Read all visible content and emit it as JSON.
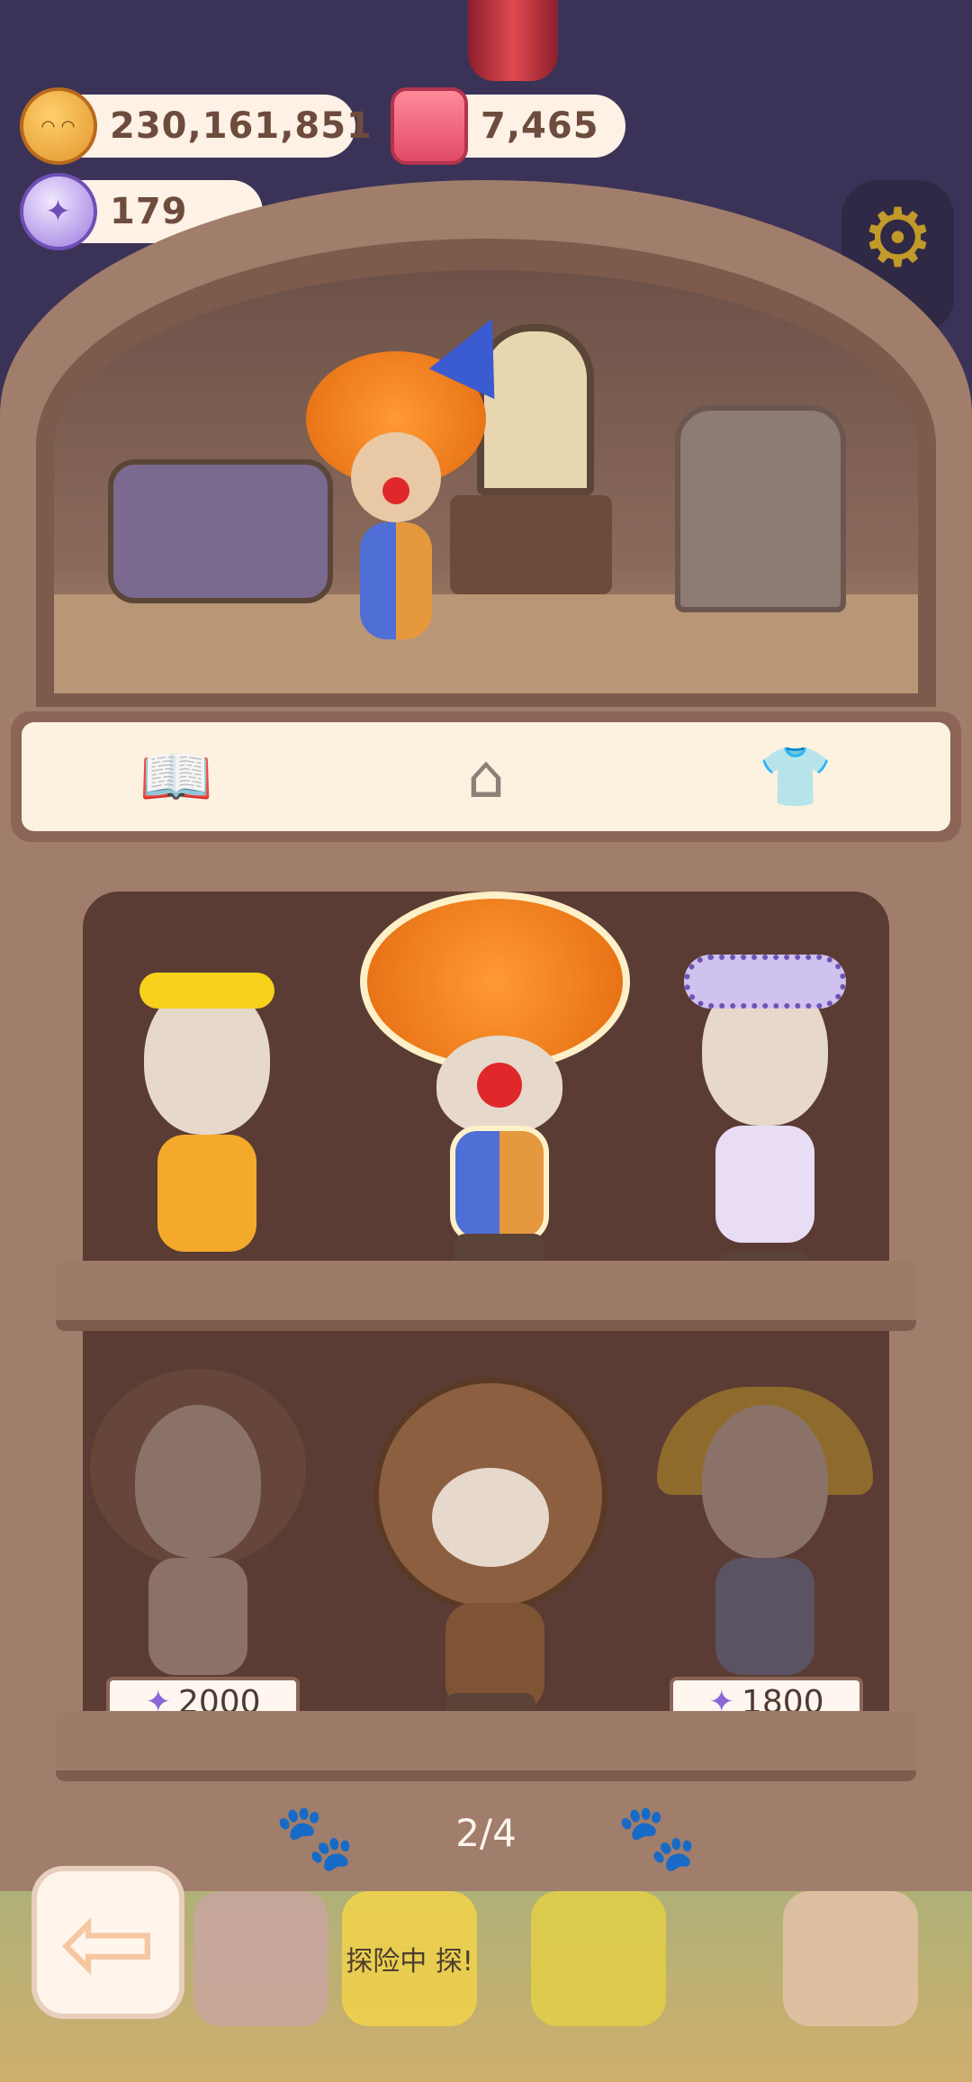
{
  "currencies": {
    "cookies": {
      "icon": "cookie-icon",
      "value": "230,161,851"
    },
    "candles": {
      "icon": "candle-icon",
      "value": "7,465"
    },
    "gems": {
      "icon": "gem-icon",
      "value": "179"
    }
  },
  "tabs": [
    {
      "icon": "book-icon",
      "selected": false
    },
    {
      "icon": "house-icon",
      "selected": false
    },
    {
      "icon": "shirt-icon",
      "selected": true
    }
  ],
  "outfits": [
    {
      "row": 1,
      "col": 1,
      "owned": true,
      "selected": false
    },
    {
      "row": 1,
      "col": 2,
      "owned": true,
      "selected": true
    },
    {
      "row": 1,
      "col": 3,
      "owned": true,
      "selected": false
    },
    {
      "row": 2,
      "col": 1,
      "owned": false,
      "price": "2000",
      "currency_icon": "gem-icon"
    },
    {
      "row": 2,
      "col": 2,
      "owned": true,
      "selected": false
    },
    {
      "row": 2,
      "col": 3,
      "owned": false,
      "price": "1800",
      "currency_icon": "gem-icon"
    }
  ],
  "pager": {
    "label": "2/4"
  },
  "bottom_bar": {
    "adventure_label": "探险中 探!"
  },
  "colors": {
    "cabinet": "#a17d6b",
    "shelf_back": "#5a3c34",
    "tab_bar": "#fdf1df",
    "background": "#3b3357"
  }
}
